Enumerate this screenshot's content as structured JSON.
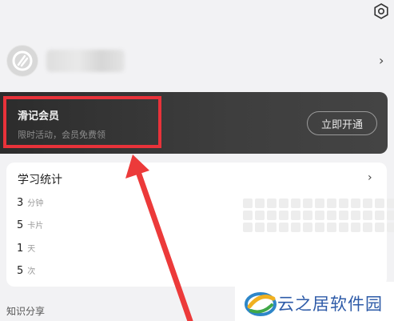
{
  "header": {
    "settings_icon": "gear-icon"
  },
  "profile": {
    "avatar_icon": "avatar-icon",
    "chevron": "›"
  },
  "vip": {
    "title": "滑记会员",
    "subtitle": "限时活动，会员免费领",
    "button_label": "立即开通"
  },
  "stats": {
    "title": "学习统计",
    "chevron": "›",
    "rows": [
      {
        "value": "3",
        "unit": "分钟"
      },
      {
        "value": "5",
        "unit": "卡片"
      },
      {
        "value": "1",
        "unit": "天"
      },
      {
        "value": "5",
        "unit": "次"
      }
    ],
    "heatmap": {
      "columns": 14,
      "rows": 3,
      "active_cell": 13,
      "active_color": "#a7dcc7"
    }
  },
  "section": {
    "title": "知识分享"
  },
  "watermark": {
    "text": "云之居软件园"
  },
  "colors": {
    "vip_bg": "#333333",
    "highlight": "#e8323a",
    "background": "#f2f2f4"
  }
}
